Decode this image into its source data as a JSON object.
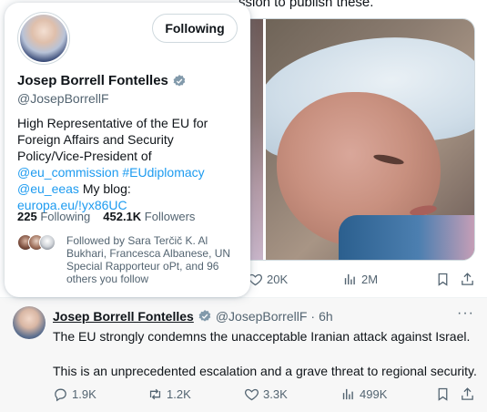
{
  "background_post": {
    "text_fragment": "ssion to publish these.",
    "actions": {
      "likes": "20K",
      "views": "2M"
    }
  },
  "hover_card": {
    "follow_button_label": "Following",
    "name": "Josep Borrell Fontelles",
    "handle": "@JosepBorrellF",
    "bio_text": "High Representative of the EU for Foreign Affairs and Security Policy/Vice-President of",
    "bio_links": [
      "@eu_commission",
      "#EUdiplomacy",
      "@eu_eeas"
    ],
    "bio_blog_label": "My blog:",
    "bio_blog_link": "europa.eu/!yx86UC",
    "following_count": "225",
    "following_label": "Following",
    "followers_count": "452.1K",
    "followers_label": "Followers",
    "followed_by_text": "Followed by Sara Terčič K. Al Bukhari, Francesca Albanese, UN Special Rapporteur oPt, and 96 others you follow"
  },
  "tweet": {
    "name": "Josep Borrell Fontelles",
    "handle": "@JosepBorrellF",
    "separator": "·",
    "time": "6h",
    "more": "···",
    "text_line1": "The EU strongly condemns the unacceptable Iranian attack against Israel.",
    "text_line2": "This is an unprecedented escalation and a grave threat to regional security.",
    "replies": "1.9K",
    "reposts": "1.2K",
    "likes": "3.3K",
    "views": "499K"
  },
  "colors": {
    "accent": "#1d9bf0",
    "text": "#0f1419",
    "muted": "#536471",
    "verified_badge": "#829aab"
  },
  "icons": [
    "verified-badge-icon",
    "reply-icon",
    "repost-icon",
    "like-icon",
    "views-icon",
    "bookmark-icon",
    "share-icon",
    "more-icon"
  ]
}
